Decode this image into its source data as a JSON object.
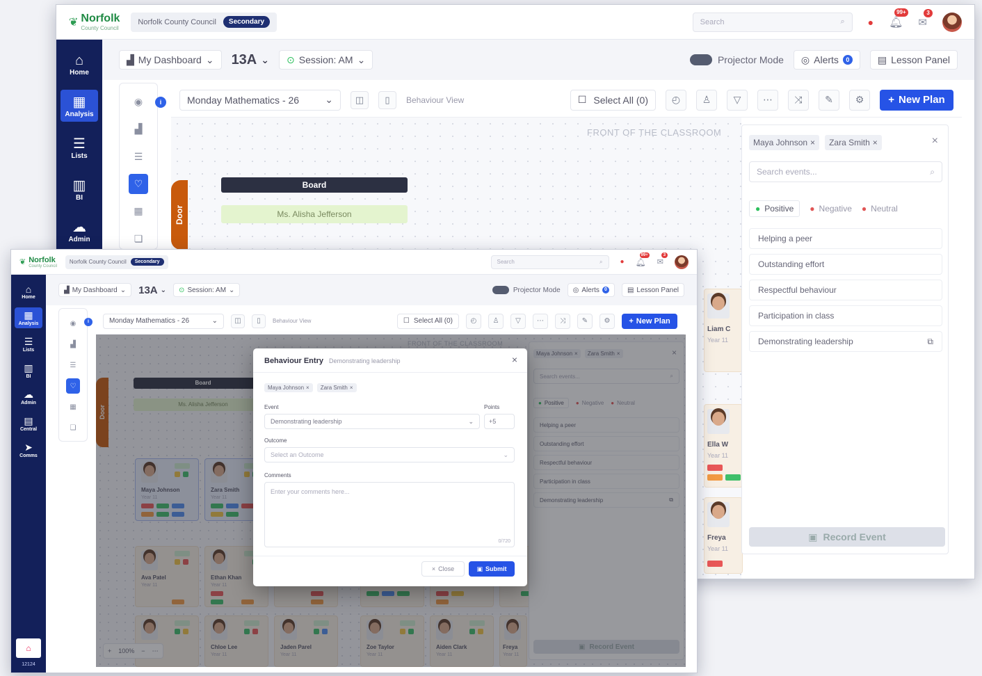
{
  "header": {
    "logo_name": "Norfolk",
    "logo_sub": "County Council",
    "org": "Norfolk County Council",
    "badge": "Secondary",
    "search_placeholder": "Search",
    "alerts_badge": "99+",
    "mail_badge": "3"
  },
  "sidebar": {
    "items": [
      {
        "label": "Home",
        "icon": "⌂"
      },
      {
        "label": "Analysis",
        "icon": "▦"
      },
      {
        "label": "Lists",
        "icon": "☰"
      },
      {
        "label": "BI",
        "icon": "▥"
      },
      {
        "label": "Admin",
        "icon": "☁"
      },
      {
        "label": "Central",
        "icon": "▤"
      },
      {
        "label": "Comms",
        "icon": "➤"
      }
    ],
    "version": "12124"
  },
  "subbar": {
    "dashboard": "My Dashboard",
    "class": "13A",
    "session": "Session: AM",
    "projector": "Projector Mode",
    "alerts": "Alerts",
    "alerts_count": "0",
    "lesson_panel": "Lesson Panel"
  },
  "lessonbar": {
    "lesson": "Monday Mathematics - 26",
    "view": "Behaviour View",
    "select_all": "Select All (0)",
    "new_plan": "New Plan"
  },
  "classroom": {
    "front": "FRONT OF THE CLASSROOM",
    "door": "Door",
    "board": "Board",
    "teacher": "Ms. Alisha Jefferson"
  },
  "panel": {
    "selected": [
      "Maya Johnson",
      "Zara Smith"
    ],
    "search_placeholder": "Search events...",
    "tabs": [
      "Positive",
      "Negative",
      "Neutral"
    ],
    "events": [
      "Helping a peer",
      "Outstanding effort",
      "Respectful behaviour",
      "Participation in class",
      "Demonstrating leadership"
    ],
    "record": "Record Event"
  },
  "students_back": [
    {
      "name": "Liam C",
      "year": "Year 11"
    },
    {
      "name": "Ella W",
      "year": "Year 11"
    },
    {
      "name": "Freya",
      "year": "Year 11"
    }
  ],
  "students_front": [
    {
      "name": "Maya Johnson",
      "year": "Year 11"
    },
    {
      "name": "Zara Smith",
      "year": "Year 11"
    },
    {
      "name": "Ava Patel",
      "year": "Year 11"
    },
    {
      "name": "Ethan Khan",
      "year": "Year 11"
    },
    {
      "name": "",
      "year": ""
    },
    {
      "name": "Chloe Lee",
      "year": "Year 11"
    },
    {
      "name": "Jaden Parel",
      "year": "Year 11"
    },
    {
      "name": "Zoe Taylor",
      "year": "Year 11"
    },
    {
      "name": "Aiden Clark",
      "year": "Year 11"
    },
    {
      "name": "Freya",
      "year": "Year 11"
    }
  ],
  "modal": {
    "title": "Behaviour Entry",
    "subtitle": "Demonstrating leadership",
    "students": [
      "Maya Johnson",
      "Zara Smith"
    ],
    "event_label": "Event",
    "event_value": "Demonstrating leadership",
    "points_label": "Points",
    "points_value": "+5",
    "outcome_label": "Outcome",
    "outcome_placeholder": "Select an Outcome",
    "comments_label": "Comments",
    "comments_placeholder": "Enter your comments here...",
    "counter": "0/720",
    "close": "Close",
    "submit": "Submit"
  },
  "zoom": {
    "value": "100%"
  }
}
